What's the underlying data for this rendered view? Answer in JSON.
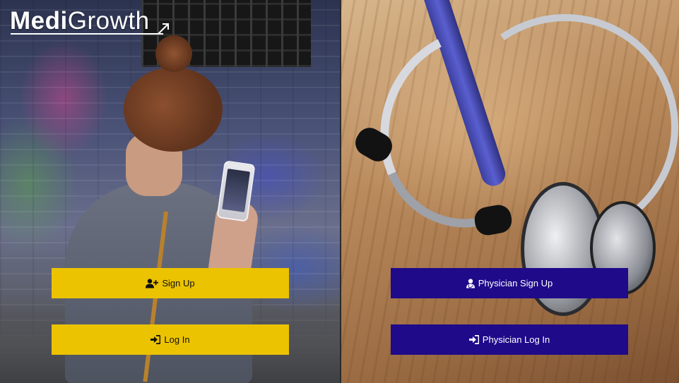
{
  "brand": {
    "logo_bold": "Medi",
    "logo_light": "Growth"
  },
  "patient": {
    "signup_label": "Sign Up",
    "signup_icon": "user-plus-icon",
    "login_label": "Log In",
    "login_icon": "sign-in-icon"
  },
  "physician": {
    "signup_label": "Physician Sign Up",
    "signup_icon": "user-doctor-icon",
    "login_label": "Physician Log In",
    "login_icon": "sign-in-icon"
  },
  "colors": {
    "patient_button": "#ebc300",
    "physician_button": "#1f0a8a",
    "logo_text": "#ffffff"
  }
}
